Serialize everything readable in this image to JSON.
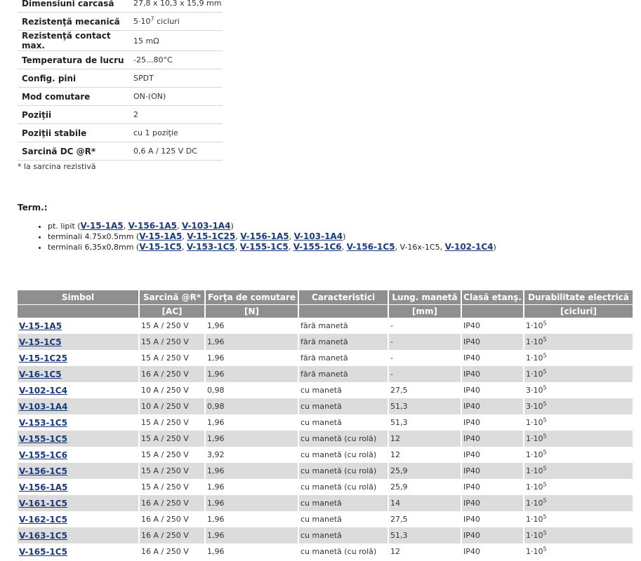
{
  "specs": [
    {
      "label": "Dimensiuni carcasă",
      "value": "27,8 x 10,3 x 15,9 mm"
    },
    {
      "label": "Rezistenţă mecanică",
      "value": "5·10",
      "sup": "7",
      "suffix": " cicluri"
    },
    {
      "label": "Rezistenţă contact max.",
      "value": "15 mΩ"
    },
    {
      "label": "Temperatura de lucru",
      "value": "-25...80°C"
    },
    {
      "label": "Config. pini",
      "value": "SPDT"
    },
    {
      "label": "Mod comutare",
      "value": "ON-(ON)"
    },
    {
      "label": "Poziţii",
      "value": "2"
    },
    {
      "label": "Poziţii stabile",
      "value": "cu 1 poziţie"
    },
    {
      "label": "Sarcină DC @R*",
      "value": "0,6 A / 125 V DC"
    }
  ],
  "footnote": "* la sarcina rezistivă",
  "term_label": "Term.:",
  "terminals": [
    {
      "prefix": "pt. lipit (",
      "items": [
        {
          "text": "V-15-1A5",
          "link": true
        },
        {
          "text": "V-156-1A5",
          "link": true
        },
        {
          "text": "V-103-1A4",
          "link": true
        }
      ]
    },
    {
      "prefix": "terminali 4.75x0.5mm (",
      "items": [
        {
          "text": "V-15-1A5",
          "link": true
        },
        {
          "text": "V-15-1C25",
          "link": true
        },
        {
          "text": "V-156-1A5",
          "link": true
        },
        {
          "text": "V-103-1A4",
          "link": true
        }
      ]
    },
    {
      "prefix": "terminali 6,35x0,8mm (",
      "items": [
        {
          "text": "V-15-1C5",
          "link": true
        },
        {
          "text": "V-153-1C5",
          "link": true
        },
        {
          "text": "V-155-1C5",
          "link": true
        },
        {
          "text": "V-155-1C6",
          "link": true
        },
        {
          "text": "V-156-1C5",
          "link": true
        },
        {
          "text": "V-16x-1C5",
          "link": false
        },
        {
          "text": "V-102-1C4",
          "link": true
        }
      ]
    }
  ],
  "table": {
    "headers": [
      "Simbol",
      "Sarcină @R*",
      "Forţa de comutare",
      "Caracteristici",
      "Lung. manetă",
      "Clasă etanş.",
      "Durabilitate electrică"
    ],
    "units": [
      "",
      "[AC]",
      "[N]",
      "",
      "[mm]",
      "",
      "[cicluri]"
    ],
    "rows": [
      {
        "sym": "V-15-1A5",
        "load": "15 A / 250 V",
        "force": "1,96",
        "feat": "fără manetă",
        "len": "-",
        "ip": "IP40",
        "dur": "1·10",
        "exp": "5"
      },
      {
        "sym": "V-15-1C5",
        "load": "15 A / 250 V",
        "force": "1,96",
        "feat": "fără manetă",
        "len": "-",
        "ip": "IP40",
        "dur": "1·10",
        "exp": "5"
      },
      {
        "sym": "V-15-1C25",
        "load": "15 A / 250 V",
        "force": "1,96",
        "feat": "fără manetă",
        "len": "-",
        "ip": "IP40",
        "dur": "1·10",
        "exp": "5"
      },
      {
        "sym": "V-16-1C5",
        "load": "16 A / 250 V",
        "force": "1,96",
        "feat": "fără manetă",
        "len": "-",
        "ip": "IP40",
        "dur": "1·10",
        "exp": "5"
      },
      {
        "sym": "V-102-1C4",
        "load": "10 A / 250 V",
        "force": "0,98",
        "feat": "cu manetă",
        "len": "27,5",
        "ip": "IP40",
        "dur": "3·10",
        "exp": "5"
      },
      {
        "sym": "V-103-1A4",
        "load": "10 A / 250 V",
        "force": "0,98",
        "feat": "cu manetă",
        "len": "51,3",
        "ip": "IP40",
        "dur": "3·10",
        "exp": "5"
      },
      {
        "sym": "V-153-1C5",
        "load": "15 A / 250 V",
        "force": "1,96",
        "feat": "cu manetă",
        "len": "51,3",
        "ip": "IP40",
        "dur": "1·10",
        "exp": "5"
      },
      {
        "sym": "V-155-1C5",
        "load": "15 A / 250 V",
        "force": "1,96",
        "feat": "cu manetă (cu rolă)",
        "len": "12",
        "ip": "IP40",
        "dur": "1·10",
        "exp": "5"
      },
      {
        "sym": "V-155-1C6",
        "load": "15 A / 250 V",
        "force": "3,92",
        "feat": "cu manetă (cu rolă)",
        "len": "12",
        "ip": "IP40",
        "dur": "1·10",
        "exp": "5"
      },
      {
        "sym": "V-156-1C5",
        "load": "15 A / 250 V",
        "force": "1,96",
        "feat": "cu manetă (cu rolă)",
        "len": "25,9",
        "ip": "IP40",
        "dur": "1·10",
        "exp": "5"
      },
      {
        "sym": "V-156-1A5",
        "load": "15 A / 250 V",
        "force": "1,96",
        "feat": "cu manetă (cu rolă)",
        "len": "25,9",
        "ip": "IP40",
        "dur": "1·10",
        "exp": "5"
      },
      {
        "sym": "V-161-1C5",
        "load": "16 A / 250 V",
        "force": "1,96",
        "feat": "cu manetă",
        "len": "14",
        "ip": "IP40",
        "dur": "1·10",
        "exp": "5"
      },
      {
        "sym": "V-162-1C5",
        "load": "16 A / 250 V",
        "force": "1,96",
        "feat": "cu manetă",
        "len": "27,5",
        "ip": "IP40",
        "dur": "1·10",
        "exp": "5"
      },
      {
        "sym": "V-163-1C5",
        "load": "16 A / 250 V",
        "force": "1,96",
        "feat": "cu manetă",
        "len": "51,3",
        "ip": "IP40",
        "dur": "1·10",
        "exp": "5"
      },
      {
        "sym": "V-165-1C5",
        "load": "16 A / 250 V",
        "force": "1,96",
        "feat": "cu manetă (cu rolă)",
        "len": "12",
        "ip": "IP40",
        "dur": "1·10",
        "exp": "5"
      }
    ]
  }
}
